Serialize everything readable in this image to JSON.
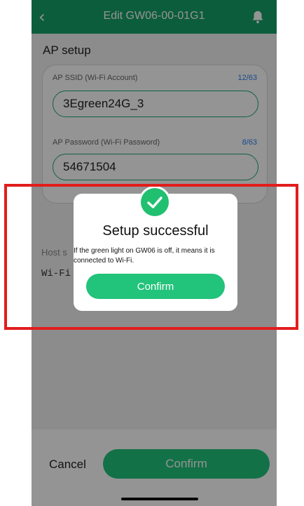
{
  "header": {
    "title": "Edit GW06-00-01G1",
    "back_icon": "chevron-left-icon",
    "bell_icon": "bell-icon",
    "accent_color": "#16a066"
  },
  "ap_setup": {
    "title": "AP setup",
    "ssid": {
      "label": "AP SSID (Wi-Fi Account)",
      "count": "12/63",
      "value": "3Egreen24G_3"
    },
    "password": {
      "label": "AP Password (Wi-Fi Password)",
      "count": "8/63",
      "value": "54671504"
    }
  },
  "host": {
    "label": "Host s",
    "value": "Wi-Fi"
  },
  "bottom_bar": {
    "cancel_label": "Cancel",
    "confirm_label": "Confirm"
  },
  "dialog": {
    "icon": "checkmark-icon",
    "title": "Setup successful",
    "message": "If the green light on GW06 is off, it means it is connected to Wi-Fi.",
    "confirm_label": "Confirm",
    "success_color": "#20c070"
  },
  "annotation": {
    "highlight_color": "#e21d1d"
  }
}
